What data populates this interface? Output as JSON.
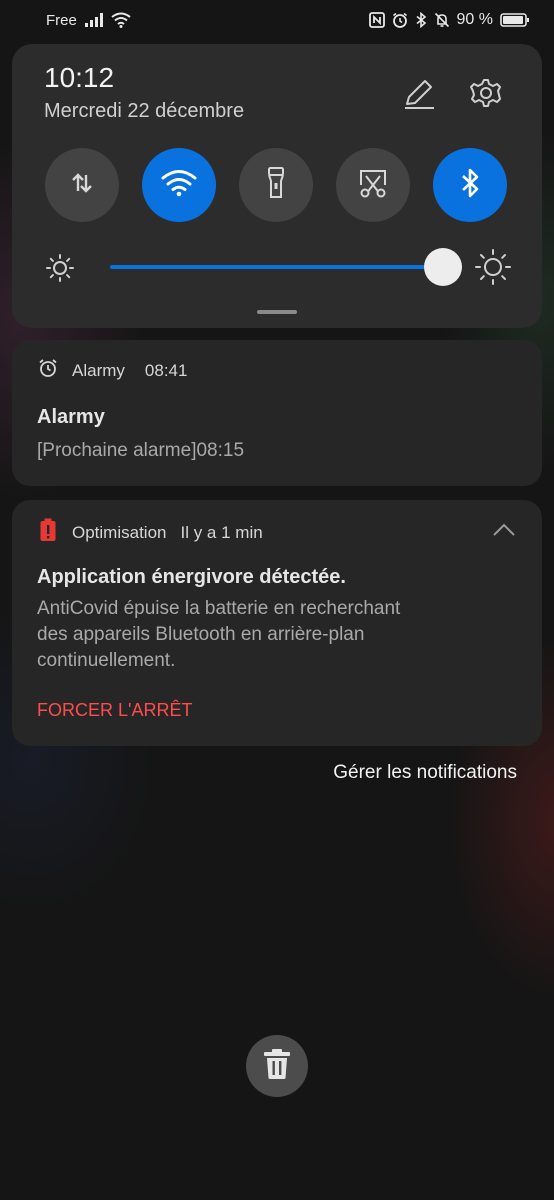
{
  "status_bar": {
    "carrier": "Free",
    "battery_percent": "90 %",
    "icons": [
      "signal-icon",
      "wifi-icon",
      "nfc-icon",
      "alarm-icon",
      "bluetooth-icon",
      "mute-icon",
      "battery-icon"
    ]
  },
  "quick_settings": {
    "time": "10:12",
    "date": "Mercredi 22 décembre",
    "toggles": [
      {
        "name": "mobile-data-toggle",
        "icon": "mobile-data-icon",
        "active": false
      },
      {
        "name": "wifi-toggle",
        "icon": "wifi-icon",
        "active": true
      },
      {
        "name": "flashlight-toggle",
        "icon": "flashlight-icon",
        "active": false
      },
      {
        "name": "screenshot-toggle",
        "icon": "screenshot-scissors-icon",
        "active": false
      },
      {
        "name": "bluetooth-toggle",
        "icon": "bluetooth-icon",
        "active": true
      }
    ],
    "brightness_level": 1.0,
    "accent_color": "#0a72de"
  },
  "notifications": [
    {
      "app": "Alarmy",
      "time": "08:41",
      "icon": "alarm-clock-icon",
      "title": "Alarmy",
      "text": "[Prochaine alarme]08:15"
    },
    {
      "app": "Optimisation",
      "time": "Il y a 1 min",
      "icon": "battery-alert-icon",
      "title": "Application énergivore détectée.",
      "text_lines": [
        "AntiCovid épuise la batterie en recherchant",
        "des appareils Bluetooth en arrière-plan",
        "continuellement."
      ],
      "action": "FORCER L'ARRÊT",
      "action_color": "#ff4d4d"
    }
  ],
  "manage_label": "Gérer les notifications",
  "clear_all_icon": "trash-icon"
}
